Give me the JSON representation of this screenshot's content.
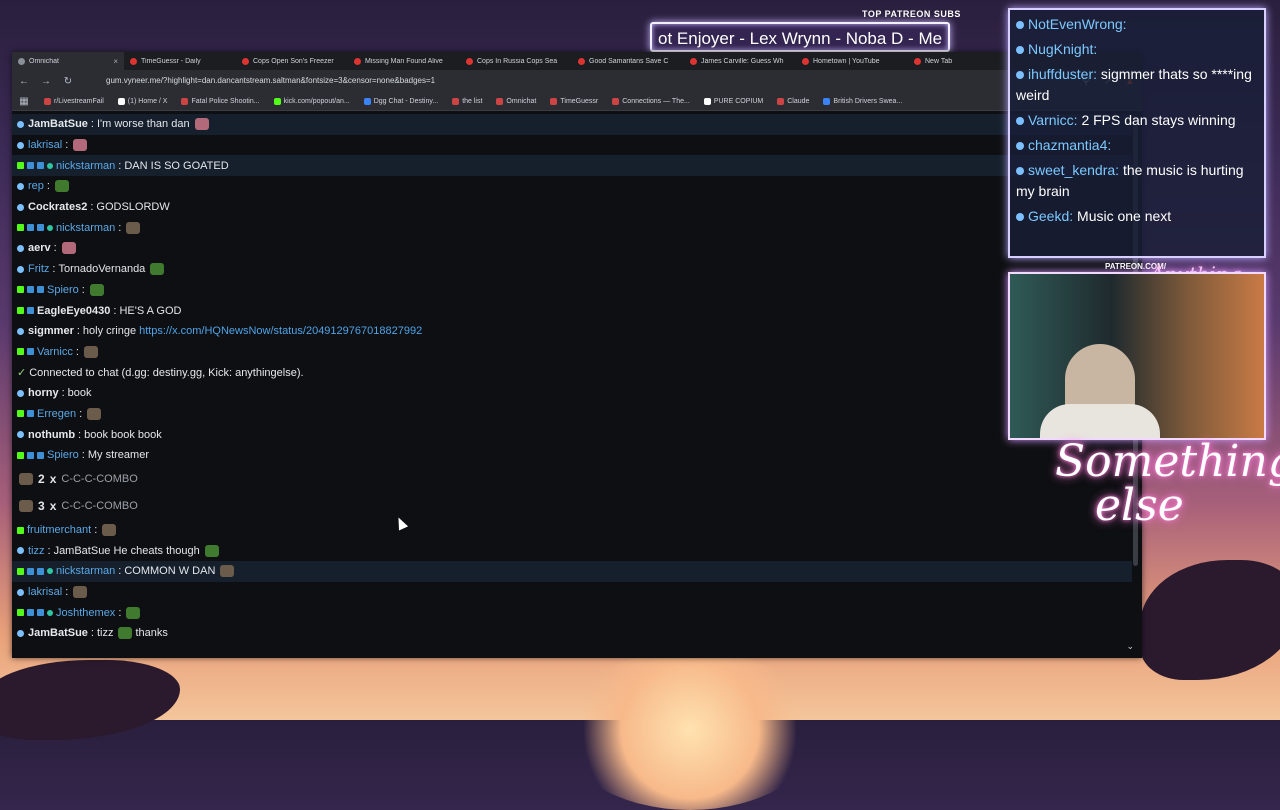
{
  "overlay": {
    "top_subs_label": "TOP PATREON SUBS",
    "banner_text": "ot Enjoyer - Lex Wrynn -  Noba D - Me",
    "patreon_label": "PATREON.COM/",
    "signature": "Anything else",
    "neon_text_1": "Something",
    "neon_text_2": "else",
    "chat": [
      {
        "user": "NotEvenWrong:",
        "text": ""
      },
      {
        "user": "NugKnight:",
        "text": ""
      },
      {
        "user": "ihuffduster:",
        "text": "sigmmer thats so ****ing weird"
      },
      {
        "user": "Varnicc:",
        "text": "2 FPS dan stays winning"
      },
      {
        "user": "chazmantia4:",
        "text": ""
      },
      {
        "user": "sweet_kendra:",
        "text": "the music is hurting my brain"
      },
      {
        "user": "Geekd:",
        "text": "Music one next"
      }
    ]
  },
  "browser": {
    "tabs": [
      {
        "label": "Omnichat",
        "active": true
      },
      {
        "label": "TimeGuessr - Daily"
      },
      {
        "label": "Cops Open Son's Freezer"
      },
      {
        "label": "Missing Man Found Alive"
      },
      {
        "label": "Cops In Russia Cops Sea"
      },
      {
        "label": "Good Samaritans Save C"
      },
      {
        "label": "James Carville: Guess Wh"
      },
      {
        "label": "Hometown | YouTube"
      },
      {
        "label": "New Tab"
      }
    ],
    "url": "gum.vyneer.me/?highlight=dan.dancantstream.saltman&fontsize=3&censor=none&badges=1",
    "bookmarks": [
      "r/LivestreamFail",
      "(1) Home / X",
      "Fatal Police Shootin...",
      "kick.com/popout/an...",
      "Dgg Chat - Destiny...",
      "the list",
      "Omnichat",
      "TimeGuessr",
      "Connections — The...",
      "PURE COPIUM",
      "Claude",
      "British Drivers Swea..."
    ]
  },
  "chat": {
    "messages": [
      {
        "user": "JamBatSue",
        "text": "I'm worse than dan",
        "style": "bold",
        "hl": true,
        "badges": "d",
        "emote": "pk"
      },
      {
        "user": "lakrisal",
        "text": "",
        "style": "blue",
        "badges": "d",
        "emote": "pk"
      },
      {
        "user": "nickstarman",
        "text": "DAN IS SO GOATED",
        "style": "blue",
        "hl": true,
        "badges": "kbbs"
      },
      {
        "user": "rep",
        "text": "",
        "style": "blue",
        "badges": "d",
        "emote": "gr"
      },
      {
        "user": "Cockrates2",
        "text": "GODSLORDW",
        "style": "bold",
        "badges": "d"
      },
      {
        "user": "nickstarman",
        "text": "",
        "style": "blue",
        "badges": "kbbs",
        "emote": "x"
      },
      {
        "user": "aerv",
        "text": "",
        "style": "bold",
        "badges": "d",
        "emote": "pk"
      },
      {
        "user": "Fritz",
        "text": "TornadoVernanda",
        "style": "blue",
        "badges": "d",
        "emote": "gr"
      },
      {
        "user": "Spiero",
        "text": "",
        "style": "blue",
        "badges": "kbb",
        "emote": "gr"
      },
      {
        "user": "EagleEye0430",
        "text": "HE'S A GOD",
        "style": "bold",
        "badges": "kb"
      },
      {
        "user": "sigmmer",
        "text": "holy",
        "text2": "cringe",
        "link": "https://x.com/HQNewsNow/status/2049129767018827992",
        "style": "bold",
        "badges": "d"
      },
      {
        "user": "Varnicc",
        "text": "",
        "style": "blue",
        "badges": "kb",
        "emote": "x"
      },
      {
        "system": "Connected to chat (d.gg: destiny.gg, Kick: anythingelse)."
      },
      {
        "user": "horny",
        "text": "book",
        "style": "bold",
        "badges": "d"
      },
      {
        "user": "Erregen",
        "text": "",
        "style": "blue",
        "badges": "kb",
        "emote": "x"
      },
      {
        "user": "nothumb",
        "text": "book book book",
        "style": "bold",
        "badges": "d"
      },
      {
        "user": "Spiero",
        "text": "My streamer",
        "style": "blue",
        "badges": "kbb"
      },
      {
        "combo": "2",
        "combo_label": "x",
        "combo_text": "C-C-C-COMBO"
      },
      {
        "combo": "3",
        "combo_label": "x",
        "combo_text": "C-C-C-COMBO"
      },
      {
        "user": "fruitmerchant",
        "text": "",
        "style": "blue",
        "badges": "k",
        "emote": "x"
      },
      {
        "user": "tizz",
        "text": "JamBatSue He cheats though",
        "style": "blue",
        "badges": "d",
        "emote": "gr"
      },
      {
        "user": "nickstarman",
        "text": "COMMON W DAN",
        "style": "blue",
        "hl": true,
        "badges": "kbbs",
        "emote": "x"
      },
      {
        "user": "lakrisal",
        "text": "",
        "style": "blue",
        "badges": "d",
        "emote": "x"
      },
      {
        "user": "Joshthemex",
        "text": "",
        "style": "blue",
        "badges": "kbbs",
        "emote": "gr"
      },
      {
        "user": "JamBatSue",
        "text": "tizz",
        "text2": "thanks",
        "style": "bold",
        "badges": "d",
        "emote": "gr"
      }
    ]
  }
}
